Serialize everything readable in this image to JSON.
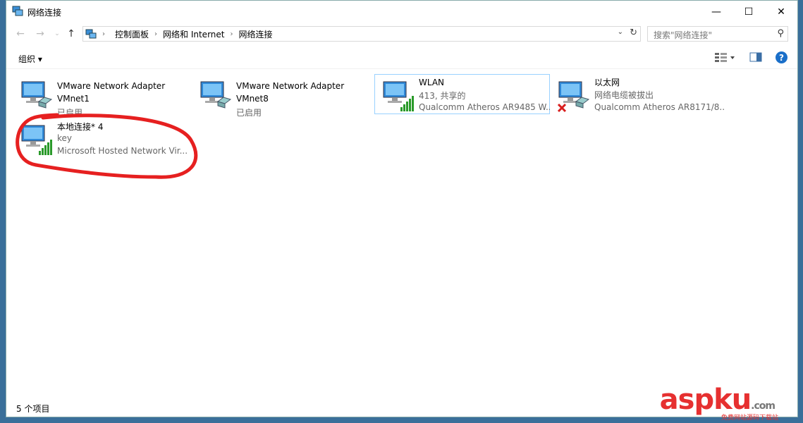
{
  "window": {
    "title": "网络连接"
  },
  "nav": {
    "breadcrumbs": [
      "控制面板",
      "网络和 Internet",
      "网络连接"
    ],
    "search_placeholder": "搜索\"网络连接\""
  },
  "toolbar": {
    "organize_label": "组织 ▾"
  },
  "items": [
    {
      "name": "VMware Network Adapter",
      "line2": "VMnet1",
      "line3": "已启用",
      "icon": "network-adapter-icon"
    },
    {
      "name": "VMware Network Adapter",
      "line2": "VMnet8",
      "line3": "已启用",
      "icon": "network-adapter-icon"
    },
    {
      "name": "WLAN",
      "line2": "413, 共享的",
      "line3": "Qualcomm Atheros AR9485 W...",
      "icon": "wireless-adapter-icon"
    },
    {
      "name": "以太网",
      "line2": "网络电缆被拔出",
      "line3": "Qualcomm Atheros AR8171/8...",
      "icon": "ethernet-disconnected-icon"
    },
    {
      "name": "本地连接* 4",
      "line2": "key",
      "line3": "Microsoft Hosted Network Vir...",
      "icon": "wireless-adapter-icon"
    }
  ],
  "status": {
    "count": "5 个项目"
  },
  "watermark": {
    "brand_a": "asp",
    "brand_b": "ku",
    "domain": ".com",
    "sub": "免费网站源码下载站"
  },
  "colors": {
    "accent": "#1a6fc9",
    "selection": "#99d1ff",
    "annotation": "#e62020"
  }
}
